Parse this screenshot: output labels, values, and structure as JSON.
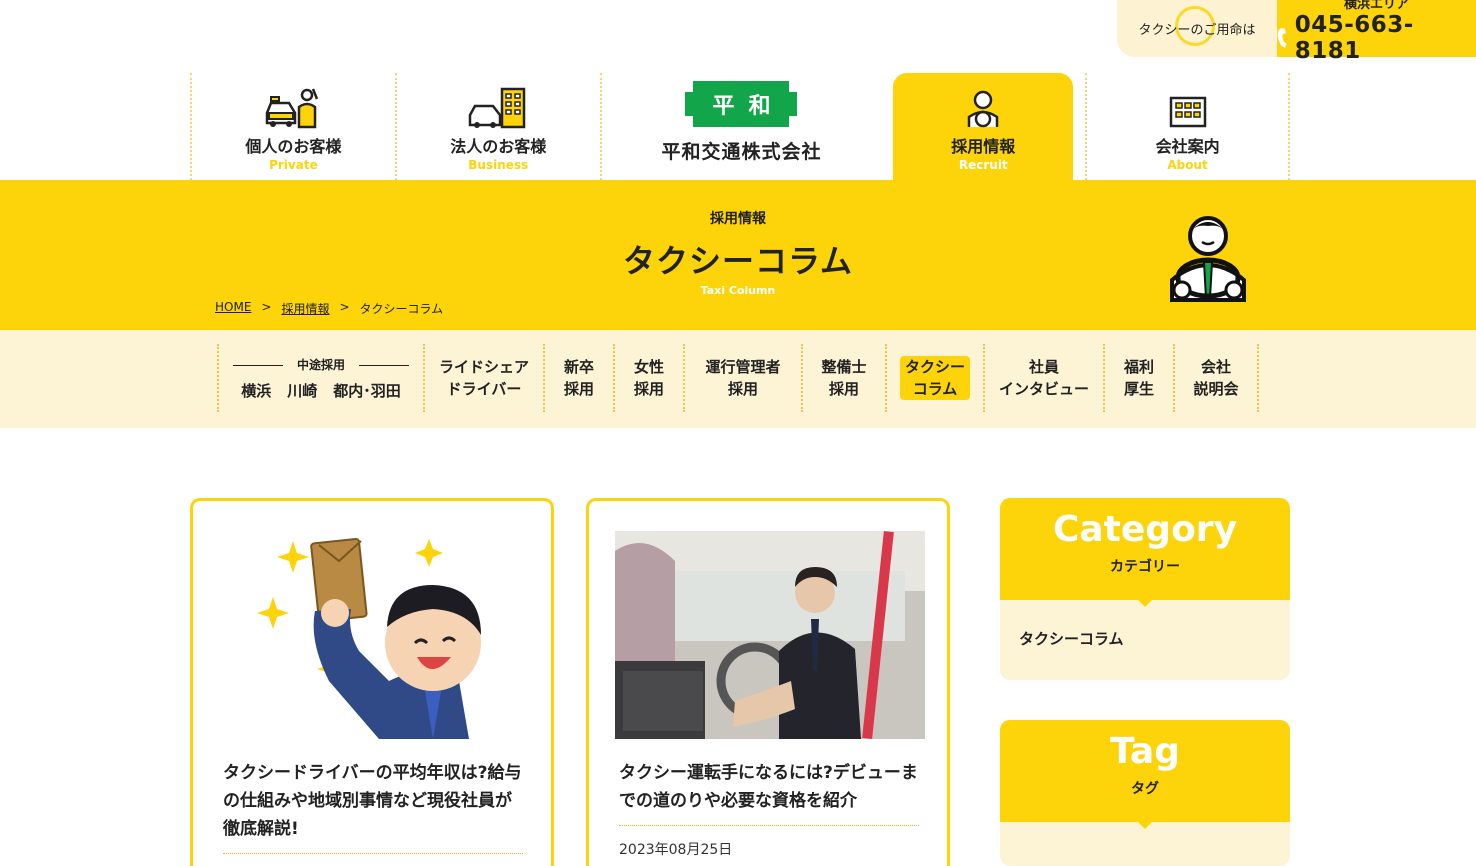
{
  "contact": {
    "label": "タクシーのご用命は",
    "area": "横浜エリア",
    "phone": "045-663-8181"
  },
  "nav": {
    "private": {
      "ja": "個人のお客様",
      "en": "Private"
    },
    "business": {
      "ja": "法人のお客様",
      "en": "Business"
    },
    "logo_mark": "平和",
    "company": "平和交通株式会社",
    "recruit": {
      "ja": "採用情報",
      "en": "Recruit"
    },
    "about": {
      "ja": "会社案内",
      "en": "About"
    }
  },
  "hero": {
    "sub": "採用情報",
    "title": "タクシーコラム",
    "en": "Taxi Column"
  },
  "breadcrumb": [
    "HOME",
    ">",
    "採用情報",
    ">",
    "タクシーコラム"
  ],
  "subnav": {
    "midcareer_head": "中途採用",
    "cities": [
      "横浜",
      "川崎",
      "都内･羽田"
    ],
    "items": [
      [
        "ライドシェア",
        "ドライバー"
      ],
      [
        "新卒",
        "採用"
      ],
      [
        "女性",
        "採用"
      ],
      [
        "運行管理者",
        "採用"
      ],
      [
        "整備士",
        "採用"
      ],
      [
        "タクシー",
        "コラム"
      ],
      [
        "社員",
        "インタビュー"
      ],
      [
        "福利",
        "厚生"
      ],
      [
        "会社",
        "説明会"
      ]
    ]
  },
  "articles": [
    {
      "title": "タクシードライバーの平均年収は?給与の仕組みや地域別事情など現役社員が徹底解説!"
    },
    {
      "title": "タクシー運転手になるには?デビューまでの道のりや必要な資格を紹介",
      "date": "2023年08月25日"
    }
  ],
  "sidebar": {
    "category": {
      "en": "Category",
      "ja": "カテゴリー",
      "items": [
        "タクシーコラム"
      ]
    },
    "tag": {
      "en": "Tag",
      "ja": "タグ"
    }
  },
  "colors": {
    "accent": "#fcd409",
    "cream": "#fdf4d6",
    "logo_green": "#12a54a"
  }
}
